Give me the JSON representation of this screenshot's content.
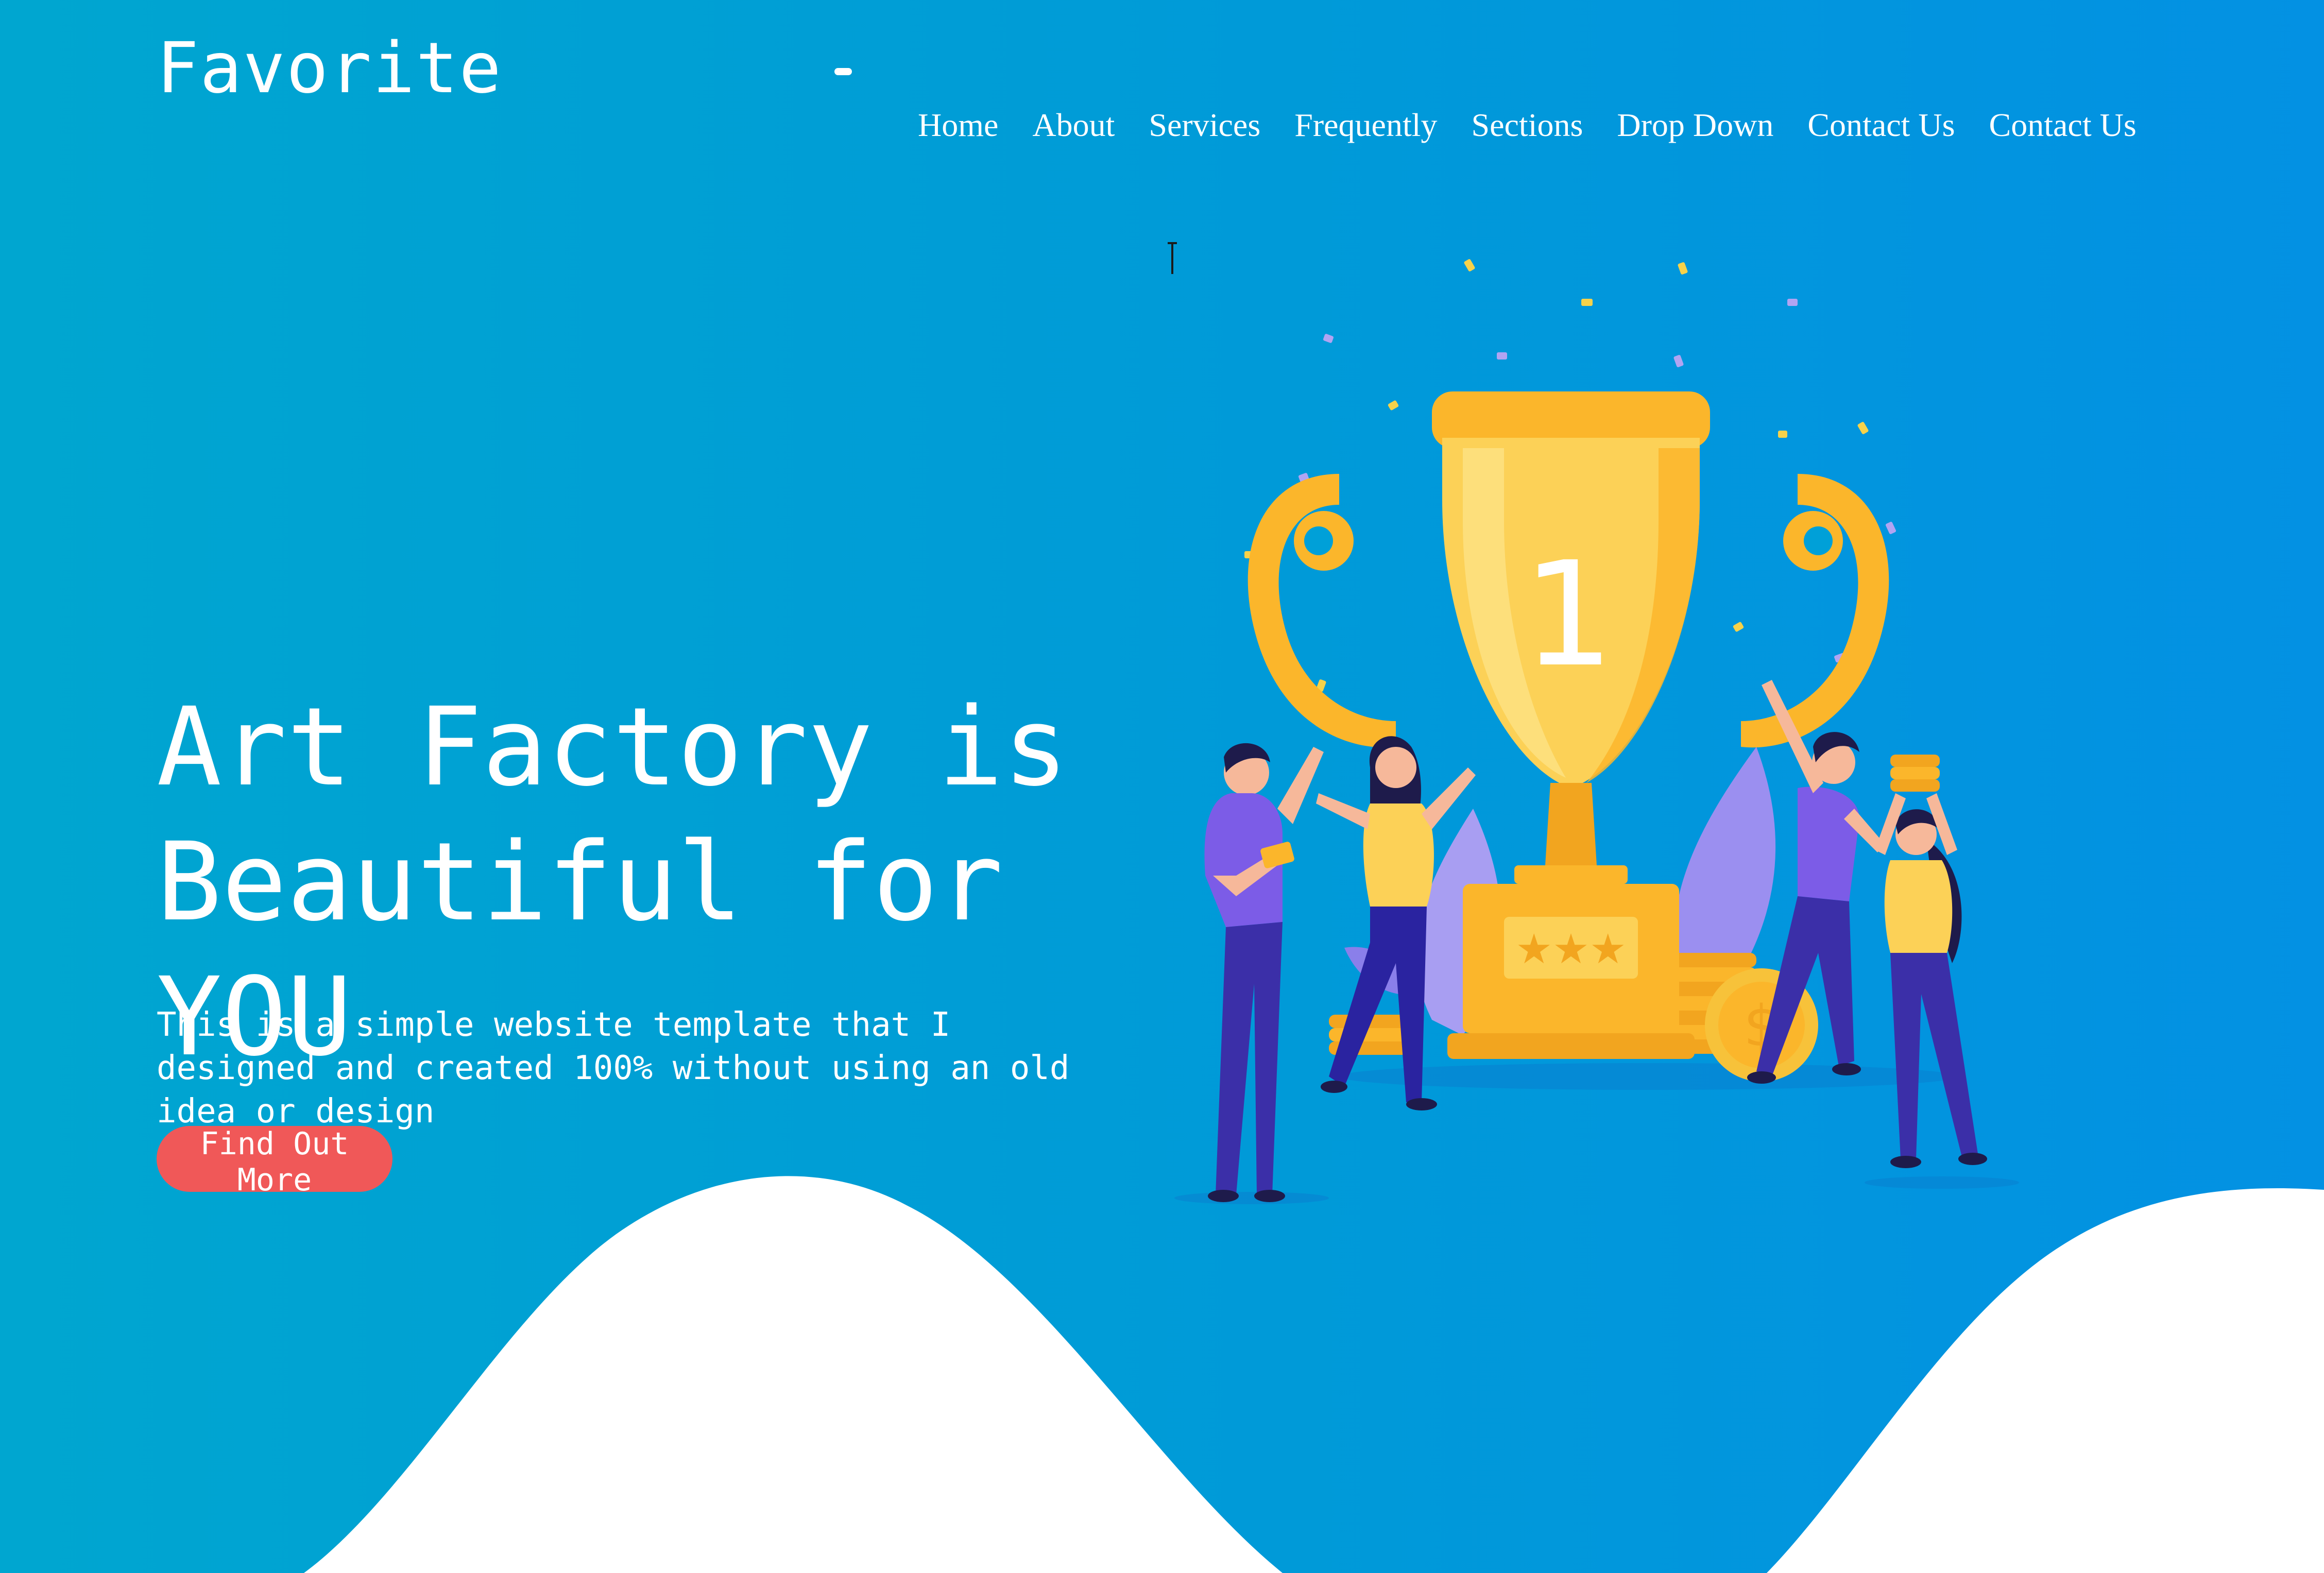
{
  "brand": {
    "logo": "Favorite"
  },
  "nav": {
    "items": [
      {
        "label": "Home"
      },
      {
        "label": "About"
      },
      {
        "label": "Services"
      },
      {
        "label": "Frequently"
      },
      {
        "label": "Sections"
      },
      {
        "label": "Drop Down"
      },
      {
        "label": "Contact Us"
      },
      {
        "label": "Contact Us"
      }
    ]
  },
  "hero": {
    "title_line1": "Art Factory is",
    "title_line2": "Beautiful for YOU",
    "description": "This is a simple website template that I designed and created 100% without using an old idea or design",
    "cta_label": "Find Out More",
    "trophy_number": "1"
  },
  "colors": {
    "background_start": "#00a6d0",
    "background_end": "#0391e3",
    "accent_button": "#f05858",
    "trophy_gold": "#fbb62b",
    "figure_purple": "#7c5ce7"
  }
}
